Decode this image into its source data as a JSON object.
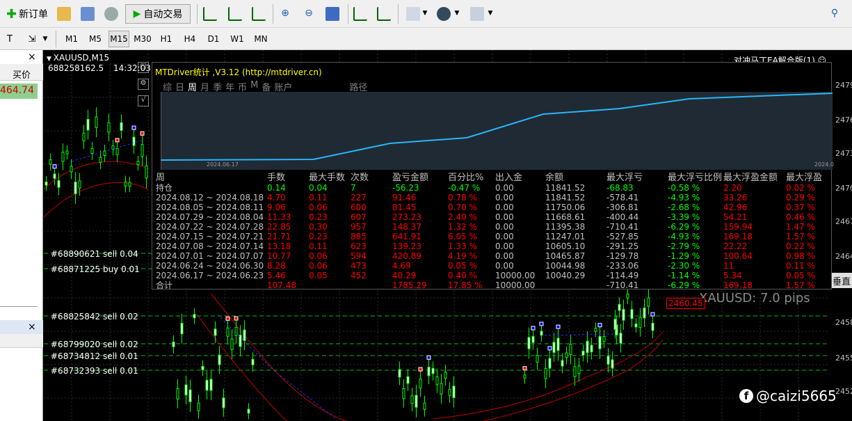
{
  "toolbar": {
    "new_order": "新订单",
    "auto_trade": "自动交易"
  },
  "timeframes": [
    "M1",
    "M5",
    "M15",
    "M30",
    "H1",
    "H4",
    "D1",
    "W1",
    "MN"
  ],
  "left_panel": {
    "buy_label": "买价",
    "buy_value": "464.74",
    "close": "×",
    "close2": "×"
  },
  "chart": {
    "symbol_tf": "XAUUSD,M15",
    "account": "688258162.5",
    "time": "14:32:03",
    "ea_name": "对冲马丁EA解合版(1) ☺",
    "pips": "XAUUSD: 7.0 pips",
    "price_tag": "2460.45",
    "watermark": "@caizi5665",
    "right_cut": "垂直"
  },
  "panel": {
    "title": "MTDriver统计 ,V3.12 (http://mtdriver.cn)",
    "tabs": [
      "综",
      "日",
      "周",
      "月",
      "季",
      "年",
      "币",
      "M",
      "备",
      "账户",
      "",
      "路径"
    ],
    "selected_tab": 2,
    "x_start": "2024.06.17",
    "x_end": "2024.0",
    "headers": [
      "周",
      "手数",
      "最大手数",
      "次数",
      "盈亏金额",
      "百分比%",
      "出入金",
      "余额",
      "最大浮亏",
      "最大浮亏比例",
      "最大浮盈金额",
      "最大浮盈"
    ],
    "rows": [
      [
        "持仓",
        "0.14",
        "0.04",
        "7",
        "-56.23",
        "-0.47 %",
        "0.00",
        "11841.52",
        "-68.83",
        "-0.58 %",
        "2.20",
        "0.02 %"
      ],
      [
        "2024.08.12 ~ 2024.08.18",
        "4.70",
        "0.11",
        "227",
        "91.46",
        "0.78 %",
        "0.00",
        "11841.52",
        "-578.41",
        "-4.93 %",
        "33.26",
        "0.29 %"
      ],
      [
        "2024.08.05 ~ 2024.08.11",
        "9.06",
        "0.06",
        "600",
        "81.45",
        "0.70 %",
        "0.00",
        "11750.06",
        "-306.81",
        "-2.68 %",
        "42.96",
        "0.37 %"
      ],
      [
        "2024.07.29 ~ 2024.08.04",
        "11.33",
        "0.23",
        "607",
        "273.23",
        "2.40 %",
        "0.00",
        "11668.61",
        "-400.44",
        "-3.39 %",
        "54.21",
        "0.46 %"
      ],
      [
        "2024.07.22 ~ 2024.07.28",
        "22.85",
        "0.30",
        "957",
        "148.37",
        "1.32 %",
        "0.00",
        "11395.38",
        "-710.41",
        "-6.29 %",
        "159.94",
        "1.47 %"
      ],
      [
        "2024.07.15 ~ 2024.07.21",
        "21.71",
        "0.23",
        "885",
        "641.91",
        "6.05 %",
        "0.00",
        "11247.01",
        "-527.85",
        "-4.93 %",
        "169.18",
        "1.57 %"
      ],
      [
        "2024.07.08 ~ 2024.07.14",
        "13.18",
        "0.11",
        "623",
        "139.23",
        "1.33 %",
        "0.00",
        "10605.10",
        "-291.25",
        "-2.79 %",
        "22.22",
        "0.22 %"
      ],
      [
        "2024.07.01 ~ 2024.07.07",
        "10.77",
        "0.06",
        "594",
        "420.89",
        "4.19 %",
        "0.00",
        "10465.87",
        "-129.78",
        "-1.29 %",
        "100.64",
        "0.98 %"
      ],
      [
        "2024.06.24 ~ 2024.06.30",
        "8.28",
        "0.06",
        "473",
        "4.69",
        "0.05 %",
        "0.00",
        "10044.98",
        "-233.06",
        "-2.30 %",
        "11",
        "0.11 %"
      ],
      [
        "2024.06.17 ~ 2024.06.23",
        "5.46",
        "0.05",
        "452",
        "40.29",
        "0.40 %",
        "10000.00",
        "10040.29",
        "-114.49",
        "-1.14 %",
        "5.34",
        "0.05 %"
      ],
      [
        "合计",
        "107.48",
        "",
        "",
        "1785.29",
        "17.85 %",
        "10000.00",
        "",
        "-710.41",
        "-6.29 %",
        "169.18",
        "1.57 %"
      ]
    ]
  },
  "orders": [
    "#68890621 sell 0.04",
    "#68871225 buy 0.01",
    "#68825842 sell 0.02",
    "#68799020 sell 0.02",
    "#68734812 sell 0.01",
    "#68732393 sell 0.01"
  ],
  "price_axis": [
    "2479",
    "2476",
    "2473",
    "2470",
    "2467",
    "2464",
    "2458",
    "2455",
    "2452"
  ],
  "colors": {
    "accent": "#ffff00",
    "equity": "#29b6f6",
    "buy": "#00ff00",
    "sell": "#ff0000",
    "bg": "#000000"
  }
}
